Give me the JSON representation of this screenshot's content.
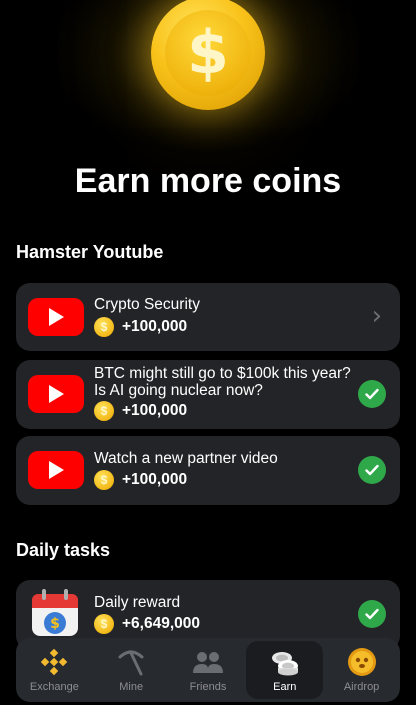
{
  "header": {
    "title": "Earn more coins",
    "coin_symbol": "$"
  },
  "youtube_section": {
    "title": "Hamster Youtube",
    "tasks": [
      {
        "title": "Crypto Security",
        "reward": "+100,000",
        "status": "pending"
      },
      {
        "title": "BTC might still go to $100k this year? Is AI going nuclear now?",
        "reward": "+100,000",
        "status": "done"
      },
      {
        "title": "Watch a new partner video",
        "reward": "+100,000",
        "status": "done"
      }
    ]
  },
  "daily_section": {
    "title": "Daily tasks",
    "tasks": [
      {
        "title": "Daily reward",
        "reward": "+6,649,000",
        "status": "done"
      }
    ]
  },
  "coin_glyph": "$",
  "nav": {
    "items": [
      {
        "label": "Exchange",
        "icon": "binance-icon"
      },
      {
        "label": "Mine",
        "icon": "pickaxe-icon"
      },
      {
        "label": "Friends",
        "icon": "friends-icon"
      },
      {
        "label": "Earn",
        "icon": "coins-icon",
        "active": true
      },
      {
        "label": "Airdrop",
        "icon": "airdrop-icon"
      }
    ]
  },
  "colors": {
    "background": "#000000",
    "card": "#232428",
    "youtube_red": "#ff0000",
    "check_green": "#2fa84a",
    "coin_gold": "#f9c21a"
  }
}
